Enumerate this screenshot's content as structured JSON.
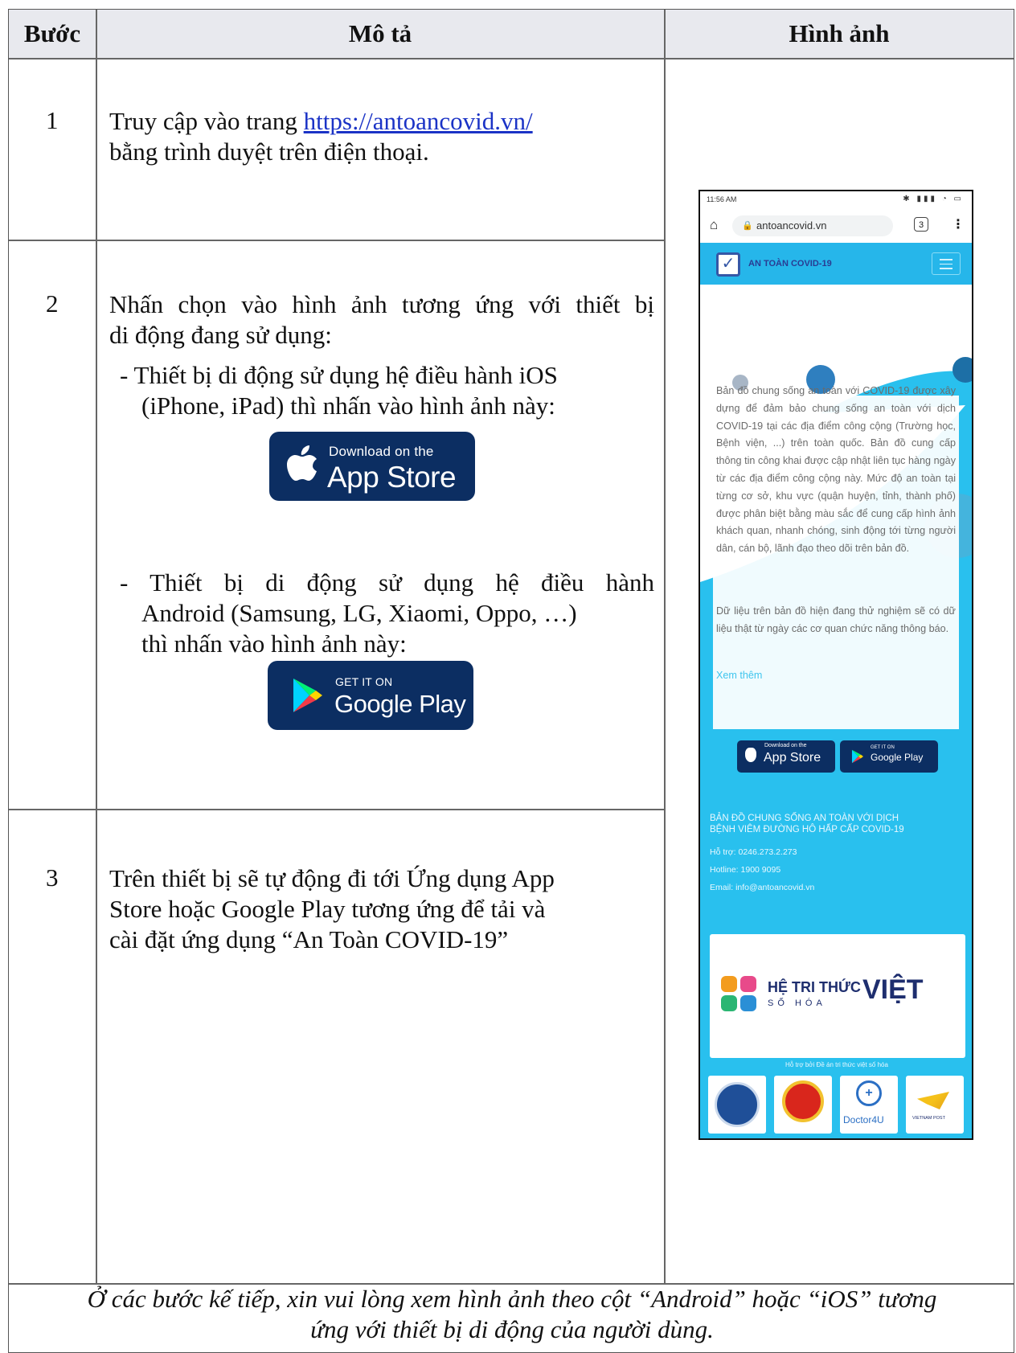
{
  "header": {
    "col_step": "Bước",
    "col_desc": "Mô tả",
    "col_image": "Hình ảnh"
  },
  "steps": [
    {
      "number": "1",
      "text_before_link": "Truy cập vào trang",
      "link": "https://antoancovid.vn/",
      "text_after_link": "bằng trình duyệt trên điện thoại."
    },
    {
      "number": "2",
      "line1": "Nhấn chọn vào hình ảnh tương ứng với thiết bị",
      "line2": "di động đang sử dụng:",
      "ios_line1": "- Thiết bị di động sử dụng hệ điều hành iOS",
      "ios_line2": "(iPhone, iPad) thì nhấn vào hình ảnh này:",
      "android_line1": "- Thiết bị di động sử dụng hệ điều hành",
      "android_line2": "Android (Samsung, LG, Xiaomi, Oppo, …)",
      "android_line3": "thì nhấn vào hình ảnh này:"
    },
    {
      "number": "3",
      "line1": "Trên thiết bị sẽ tự động đi tới Ứng dụng App",
      "line2": "Store hoặc Google Play tương ứng để tải và",
      "line3": "cài đặt ứng dụng “An Toàn COVID-19”"
    }
  ],
  "badges": {
    "appstore_small": "Download on the",
    "appstore_big": "App Store",
    "googleplay_small": "GET IT ON",
    "googleplay_big": "Google Play"
  },
  "phone": {
    "time": "11:56 AM",
    "url": "antoancovid.vn",
    "tab_count": "3",
    "brand": "AN TOÀN COVID-19",
    "card_paragraph1": "Bản đồ chung sống an toàn với COVID-19 được xây dựng để đảm bảo chung sống an toàn với dịch COVID-19 tại các địa điểm công cộng (Trường học, Bệnh viện, ...) trên toàn quốc. Bản đồ cung cấp thông tin công khai được cập nhật liên tục hàng ngày từ các địa điểm công cộng này. Mức độ an toàn tại từng cơ sở, khu vực (quận huyện, tỉnh, thành phố) được phân biệt bằng màu sắc để cung cấp hình ảnh khách quan, nhanh chóng, sinh động tới từng người dân, cán bộ, lãnh đạo theo dõi trên bản đồ.",
    "card_paragraph2": "Dữ liệu trên bản đồ hiện đang thử nghiệm sẽ có dữ liệu thật từ ngày các cơ quan chức năng thông báo.",
    "card_more": "Xem thêm",
    "footer_title1": "BẢN ĐỒ CHUNG SỐNG AN TOÀN VỚI DỊCH",
    "footer_title2": "BỆNH VIÊM ĐƯỜNG HÔ HẤP CẤP COVID-19",
    "support": "Hỗ trợ: 0246.273.2.273",
    "hotline": "Hotline: 1900 9095",
    "email": "Email: info@antoancovid.vn",
    "logo_line1": "HỆ TRI THỨC",
    "logo_line2": "SỐ HÓA",
    "logo_big": "VIỆT",
    "supported_by": "Hỗ trợ bởi Đề án tri thức việt số hóa",
    "partner_doctor": "Doctor4U",
    "partner_post": "VIETNAM POST"
  },
  "footer": {
    "line1": "Ở các bước kế tiếp, xin vui lòng xem hình ảnh theo cột “Android” hoặc “iOS” tương",
    "line2": "ứng với thiết bị di động của người dùng."
  },
  "colors": {
    "badge_bg": "#0c2e62",
    "phone_bg": "#29c0ee",
    "link": "#1b33c6"
  }
}
